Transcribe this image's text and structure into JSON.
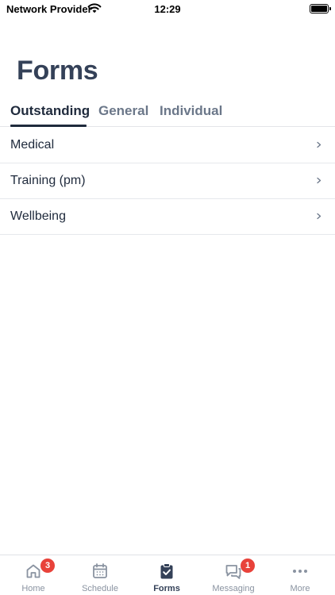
{
  "status_bar": {
    "carrier": "Network Provider",
    "time": "12:29",
    "battery_level": 1.0
  },
  "page": {
    "title": "Forms"
  },
  "tabs": [
    {
      "label": "Outstanding",
      "active": true
    },
    {
      "label": "General",
      "active": false
    },
    {
      "label": "Individual",
      "active": false
    }
  ],
  "forms": [
    {
      "label": "Medical"
    },
    {
      "label": "Training (pm)"
    },
    {
      "label": "Wellbeing"
    }
  ],
  "tab_bar": {
    "items": [
      {
        "label": "Home",
        "icon": "home-icon",
        "badge": "3"
      },
      {
        "label": "Schedule",
        "icon": "calendar-icon",
        "badge": ""
      },
      {
        "label": "Forms",
        "icon": "clipboard-check-icon",
        "badge": "",
        "active": true
      },
      {
        "label": "Messaging",
        "icon": "chat-icon",
        "badge": "1"
      },
      {
        "label": "More",
        "icon": "more-icon",
        "badge": ""
      }
    ]
  },
  "colors": {
    "primary": "#344158",
    "text": "#1f2a3c",
    "muted": "#6b7789",
    "tab_inactive": "#8a93a1",
    "badge": "#e8423a",
    "divider": "#e6e8ec"
  }
}
